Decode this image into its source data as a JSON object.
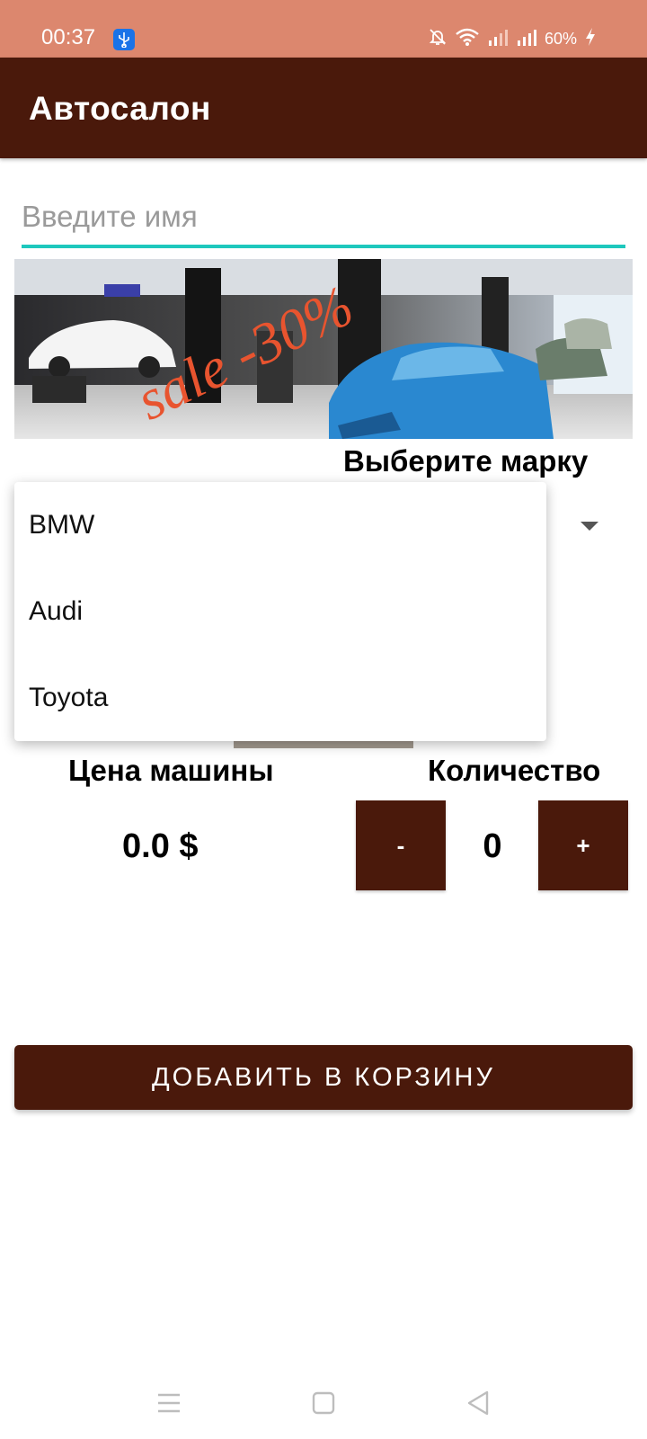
{
  "status_bar": {
    "time": "00:37",
    "battery": "60%",
    "icons": [
      "usb-icon",
      "mute-icon",
      "wifi-icon",
      "signal-icon",
      "signal-icon",
      "charging-icon"
    ]
  },
  "app_bar": {
    "title": "Автосалон"
  },
  "form": {
    "name_placeholder": "Введите имя",
    "name_value": "",
    "accent_color": "#1ec8bd"
  },
  "banner": {
    "sale_text": "sale -30%"
  },
  "brand": {
    "label": "Выберите марку",
    "options": [
      "BMW",
      "Audi",
      "Toyota"
    ]
  },
  "price": {
    "label": "Цена машины",
    "value": "0.0 $"
  },
  "quantity": {
    "label": "Количество",
    "minus_label": "-",
    "plus_label": "+",
    "value": "0"
  },
  "actions": {
    "add_to_cart_label": "ДОБАВИТЬ В КОРЗИНУ"
  },
  "colors": {
    "primary": "#4a190b",
    "status_bar": "#dc876e"
  }
}
